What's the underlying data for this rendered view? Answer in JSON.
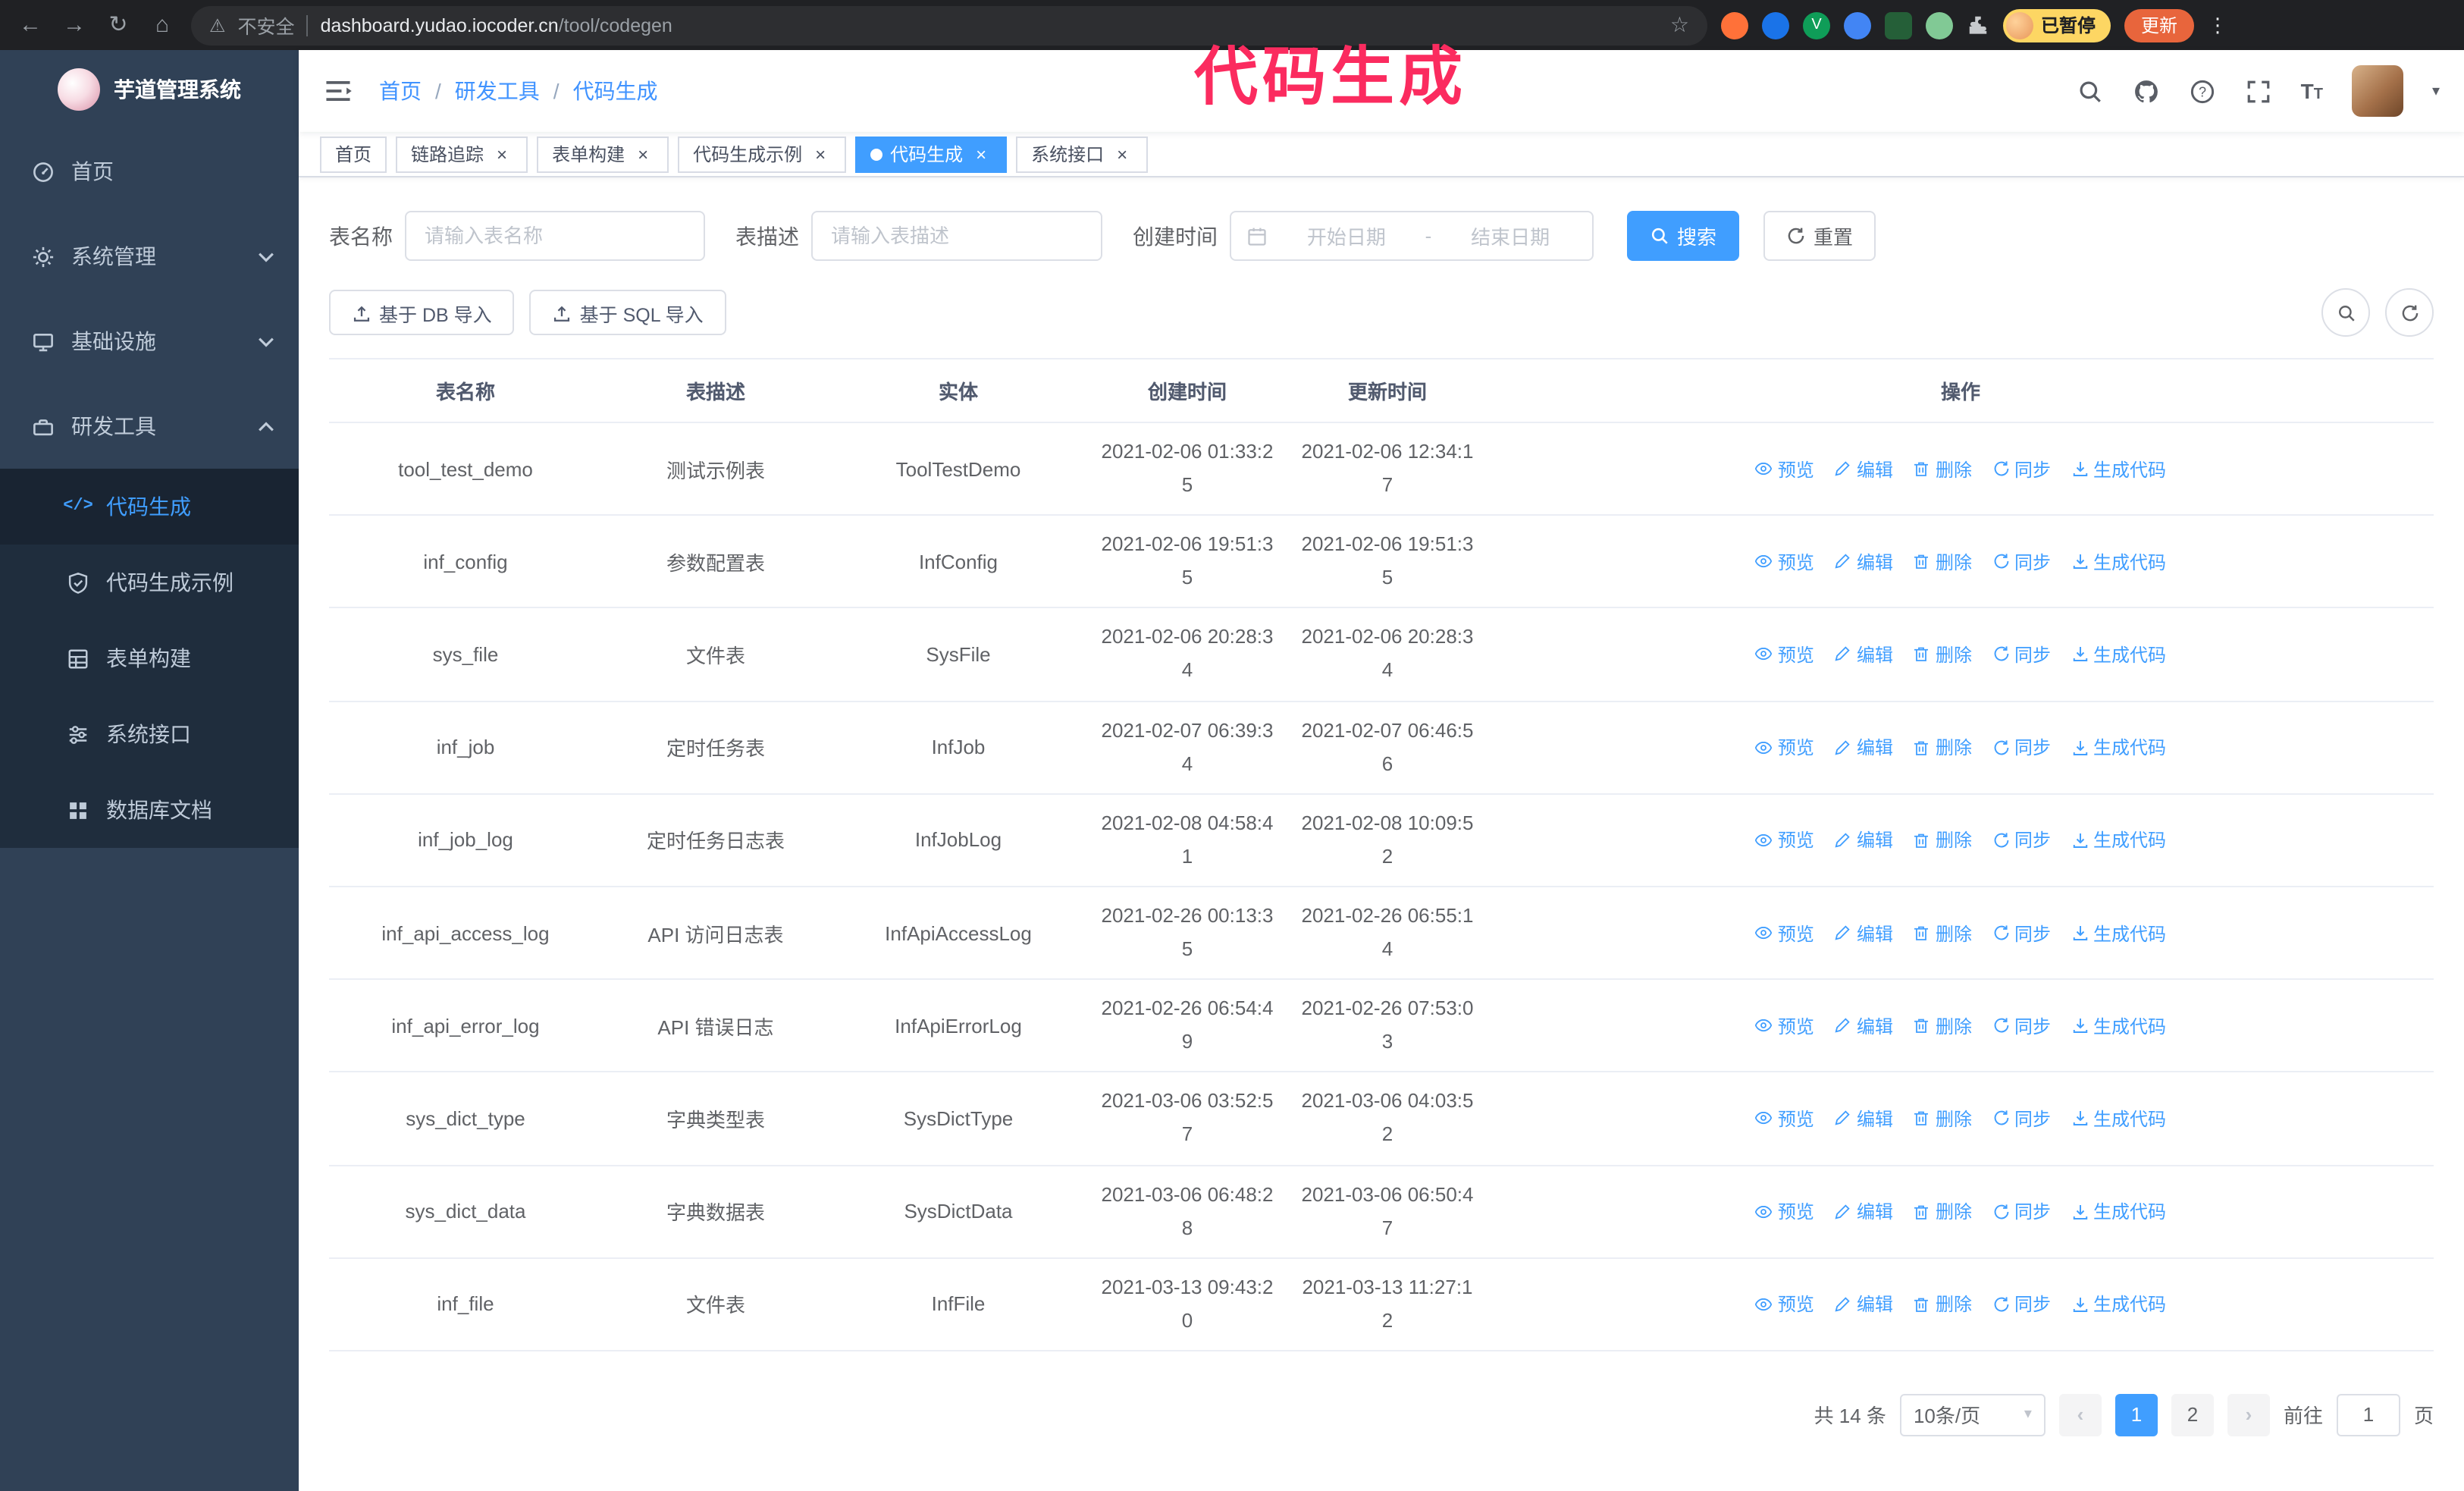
{
  "colors": {
    "accent": "#409EFF",
    "sidebar_bg": "#304156",
    "submenu_bg": "#1f2d3d",
    "annotation": "#fb2b5f",
    "active_tab_bg": "#409EFF"
  },
  "annotation": {
    "text": "代码生成"
  },
  "browser": {
    "security_label": "不安全",
    "url_domain": "dashboard.yudao.iocoder.cn",
    "url_path": "/tool/codegen",
    "profile_badge": "已暂停",
    "update_button": "更新"
  },
  "sidebar": {
    "logo_title": "芋道管理系统",
    "items": [
      {
        "label": "首页"
      },
      {
        "label": "系统管理"
      },
      {
        "label": "基础设施"
      },
      {
        "label": "研发工具"
      }
    ],
    "sub_items": [
      {
        "label": "代码生成"
      },
      {
        "label": "代码生成示例"
      },
      {
        "label": "表单构建"
      },
      {
        "label": "系统接口"
      },
      {
        "label": "数据库文档"
      }
    ]
  },
  "header": {
    "breadcrumb": [
      "首页",
      "研发工具",
      "代码生成"
    ]
  },
  "tabs": [
    {
      "label": "首页",
      "closable": false,
      "active": false
    },
    {
      "label": "链路追踪",
      "closable": true,
      "active": false
    },
    {
      "label": "表单构建",
      "closable": true,
      "active": false
    },
    {
      "label": "代码生成示例",
      "closable": true,
      "active": false
    },
    {
      "label": "代码生成",
      "closable": true,
      "active": true
    },
    {
      "label": "系统接口",
      "closable": true,
      "active": false
    }
  ],
  "filters": {
    "table_name_label": "表名称",
    "table_name_placeholder": "请输入表名称",
    "table_desc_label": "表描述",
    "table_desc_placeholder": "请输入表描述",
    "create_time_label": "创建时间",
    "date_start_placeholder": "开始日期",
    "date_separator": "-",
    "date_end_placeholder": "结束日期",
    "search_button": "搜索",
    "reset_button": "重置"
  },
  "toolbar": {
    "import_db": "基于 DB 导入",
    "import_sql": "基于 SQL 导入"
  },
  "table": {
    "columns": [
      "表名称",
      "表描述",
      "实体",
      "创建时间",
      "更新时间",
      "操作"
    ],
    "actions": [
      "预览",
      "编辑",
      "删除",
      "同步",
      "生成代码"
    ],
    "rows": [
      {
        "name": "tool_test_demo",
        "desc": "测试示例表",
        "entity": "ToolTestDemo",
        "created": "2021-02-06 01:33:25",
        "updated": "2021-02-06 12:34:17"
      },
      {
        "name": "inf_config",
        "desc": "参数配置表",
        "entity": "InfConfig",
        "created": "2021-02-06 19:51:35",
        "updated": "2021-02-06 19:51:35"
      },
      {
        "name": "sys_file",
        "desc": "文件表",
        "entity": "SysFile",
        "created": "2021-02-06 20:28:34",
        "updated": "2021-02-06 20:28:34"
      },
      {
        "name": "inf_job",
        "desc": "定时任务表",
        "entity": "InfJob",
        "created": "2021-02-07 06:39:34",
        "updated": "2021-02-07 06:46:56"
      },
      {
        "name": "inf_job_log",
        "desc": "定时任务日志表",
        "entity": "InfJobLog",
        "created": "2021-02-08 04:58:41",
        "updated": "2021-02-08 10:09:52"
      },
      {
        "name": "inf_api_access_log",
        "desc": "API 访问日志表",
        "entity": "InfApiAccessLog",
        "created": "2021-02-26 00:13:35",
        "updated": "2021-02-26 06:55:14"
      },
      {
        "name": "inf_api_error_log",
        "desc": "API 错误日志",
        "entity": "InfApiErrorLog",
        "created": "2021-02-26 06:54:49",
        "updated": "2021-02-26 07:53:03"
      },
      {
        "name": "sys_dict_type",
        "desc": "字典类型表",
        "entity": "SysDictType",
        "created": "2021-03-06 03:52:57",
        "updated": "2021-03-06 04:03:52"
      },
      {
        "name": "sys_dict_data",
        "desc": "字典数据表",
        "entity": "SysDictData",
        "created": "2021-03-06 06:48:28",
        "updated": "2021-03-06 06:50:47"
      },
      {
        "name": "inf_file",
        "desc": "文件表",
        "entity": "InfFile",
        "created": "2021-03-13 09:43:20",
        "updated": "2021-03-13 11:27:12"
      }
    ]
  },
  "pagination": {
    "total": "共 14 条",
    "page_size": "10条/页",
    "prev": "‹",
    "next": "›",
    "pages": [
      "1",
      "2"
    ],
    "active_page": "1",
    "goto_label": "前往",
    "goto_value": "1",
    "unit_label": "页"
  }
}
